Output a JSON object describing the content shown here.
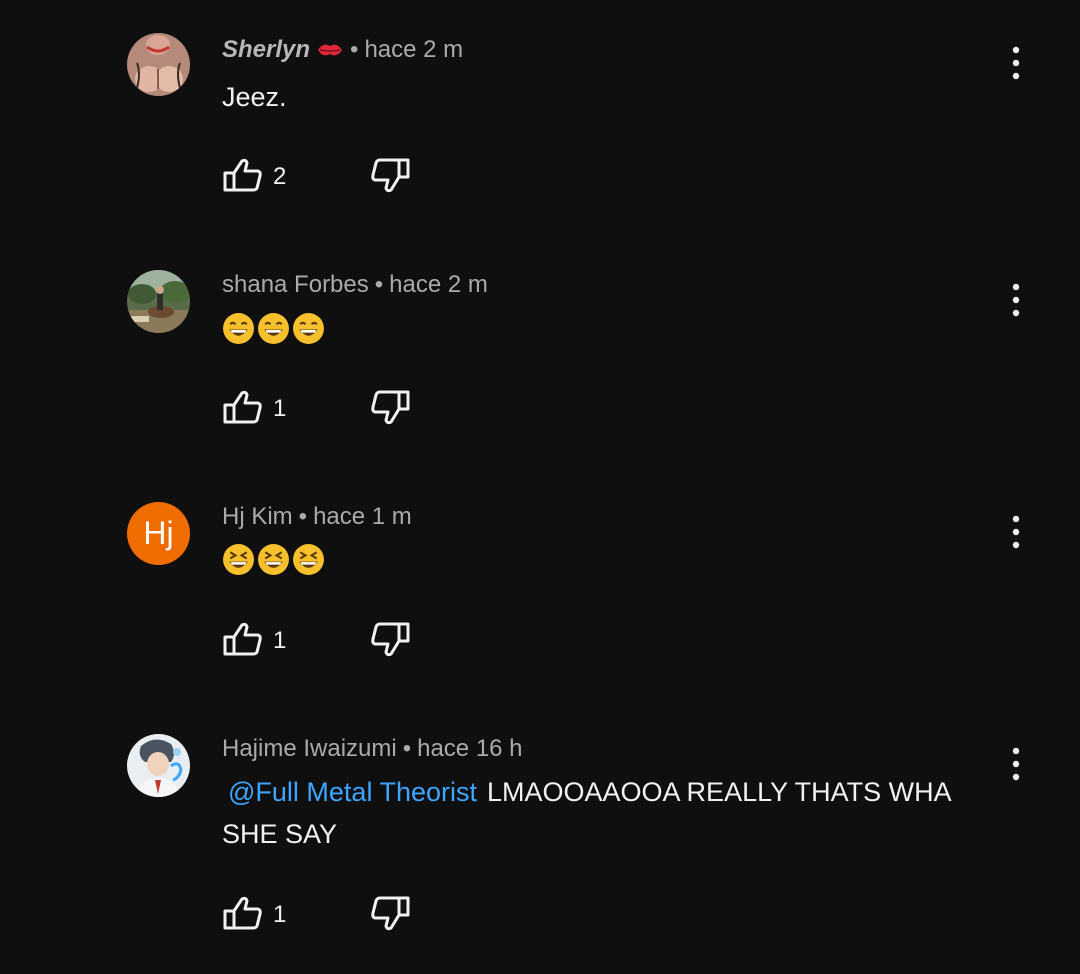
{
  "comments": [
    {
      "author": "Sherlyn",
      "author_badge": "kiss-mark-emoji",
      "separator": "•",
      "time": "hace 2 m",
      "text": "Jeez.",
      "likes": "2",
      "avatar_type": "photo"
    },
    {
      "author": "shana Forbes",
      "separator": "•",
      "time": "hace 2 m",
      "emojis": [
        "grinning-face-emoji",
        "grinning-face-emoji",
        "grinning-face-emoji"
      ],
      "likes": "1",
      "avatar_type": "photo"
    },
    {
      "author": "Hj Kim",
      "separator": "•",
      "time": "hace 1 m",
      "emojis": [
        "laughing-face-emoji",
        "laughing-face-emoji",
        "laughing-face-emoji"
      ],
      "likes": "1",
      "avatar_type": "letter",
      "avatar_letter": "Hj",
      "avatar_color": "#ef6c00"
    },
    {
      "author": "Hajime Iwaizumi",
      "separator": "•",
      "time": "hace 16 h",
      "mention": "@Full Metal Theorist",
      "text": "LMAOOAAOOA REALLY THATS WHA SHE SAY",
      "likes": "1",
      "avatar_type": "illustration"
    }
  ],
  "icons": {
    "like": "thumbs-up-icon",
    "dislike": "thumbs-down-icon",
    "more": "more-vert-icon"
  },
  "colors": {
    "background": "#0f0f0f",
    "mention": "#3ea6ff",
    "meta": "#aaaaaa",
    "text": "#f1f1f1"
  }
}
